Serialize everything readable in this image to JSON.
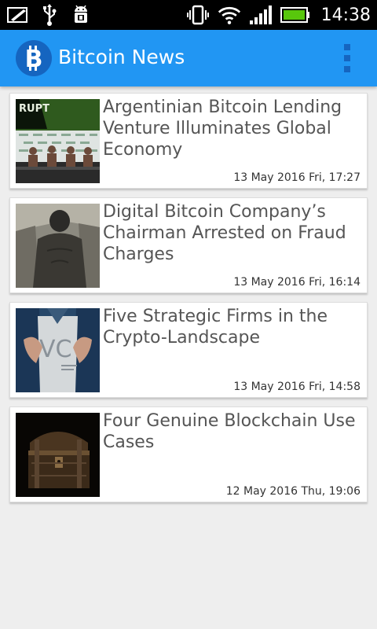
{
  "status_bar": {
    "time": "14:38",
    "left_icons": [
      "notification-pen-icon",
      "usb-icon",
      "android-debug-icon"
    ],
    "right_icons": [
      "vibrate-icon",
      "wifi-icon",
      "signal-icon",
      "battery-icon"
    ],
    "battery_level": 1.0,
    "battery_color": "#58c70c"
  },
  "app_bar": {
    "title": "Bitcoin News",
    "logo_icon": "bitcoin-logo-icon",
    "menu_icon": "overflow-menu-icon",
    "color": "#2196f3"
  },
  "articles": [
    {
      "title": "Argentinian Bitcoin Lending Venture Illuminates Global Economy",
      "date": "13 May 2016 Fri, 17:27",
      "thumbnail": "conference-panel-thumbnail"
    },
    {
      "title": "Digital Bitcoin Company’s Chairman Arrested on Fraud Charges",
      "date": "13 May 2016 Fri, 16:14",
      "thumbnail": "man-back-thumbnail"
    },
    {
      "title": "Five Strategic Firms in the Crypto-Landscape",
      "date": "13 May 2016 Fri, 14:58",
      "thumbnail": "vc-shirt-thumbnail"
    },
    {
      "title": "Four Genuine Blockchain Use Cases",
      "date": "12 May 2016 Thu, 19:06",
      "thumbnail": "treasure-chest-thumbnail"
    }
  ]
}
